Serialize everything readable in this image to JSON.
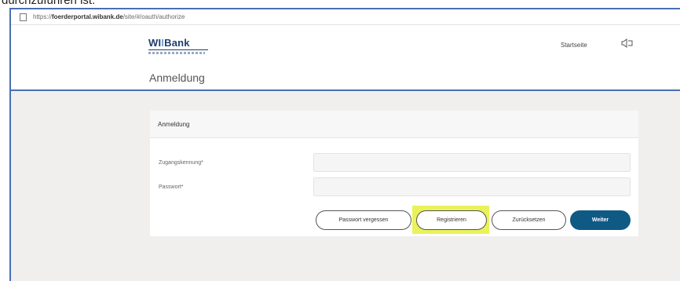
{
  "document": {
    "caption": "durchzuführen ist."
  },
  "browser": {
    "url_prefix": "https://",
    "url_host": "foerderportal.wibank.de",
    "url_path": "/site/#/oauth/authorize"
  },
  "header": {
    "logo_text_left": "WI",
    "logo_text_bars": "I",
    "logo_text_right": "Bank",
    "nav_home_label": "Startseite",
    "logout_icon": "logout-icon",
    "page_title": "Anmeldung"
  },
  "login_card": {
    "title": "Anmeldung",
    "fields": {
      "username_label": "Zugangskennung*",
      "username_value": "",
      "password_label": "Passwort*",
      "password_value": ""
    },
    "buttons": {
      "forgot_password": "Passwort vergessen",
      "register": "Registrieren",
      "reset": "Zurücksetzen",
      "continue": "Weiter"
    }
  },
  "colors": {
    "frame_border": "#4a6fb3",
    "primary_button": "#0f5a85",
    "highlight": "#eaf25a",
    "background": "#f0efee"
  }
}
